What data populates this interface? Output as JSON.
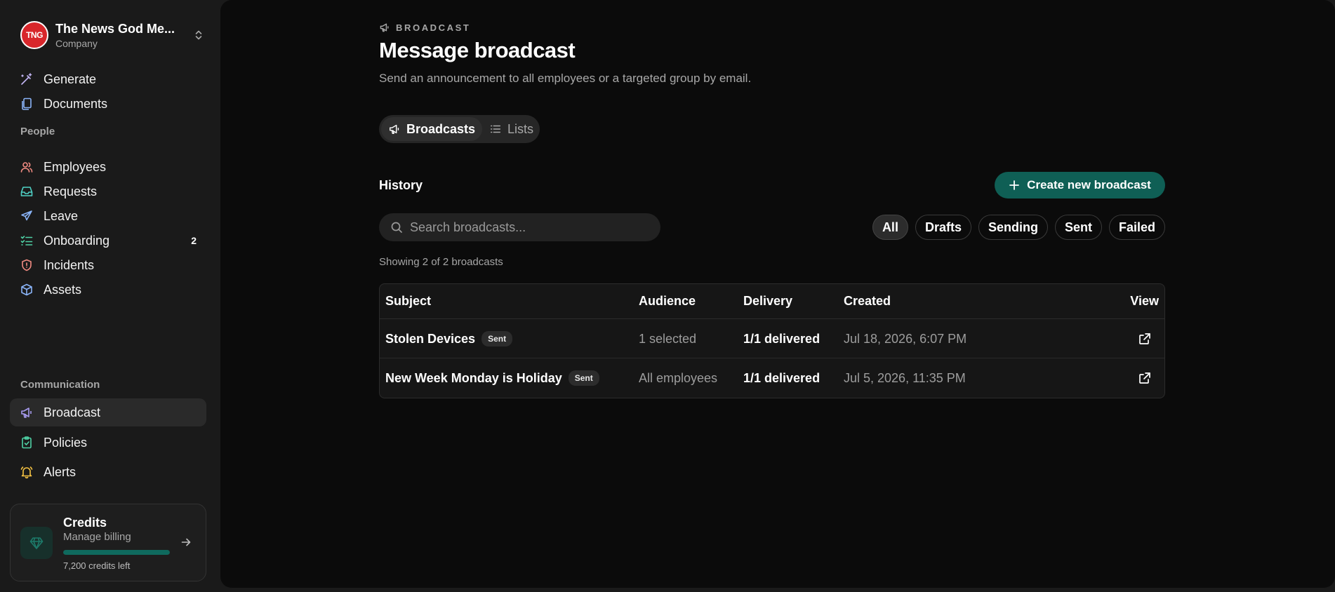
{
  "org": {
    "logo_text": "TNG",
    "name": "The News God Me...",
    "type": "Company"
  },
  "nav": {
    "top": [
      {
        "label": "Generate",
        "icon": "wand-icon",
        "color": "#c3b5f5"
      },
      {
        "label": "Documents",
        "icon": "documents-icon",
        "color": "#8ab4f8"
      }
    ],
    "people_label": "People",
    "people": [
      {
        "label": "Employees",
        "icon": "users-icon",
        "color": "#f28b82"
      },
      {
        "label": "Requests",
        "icon": "inbox-icon",
        "color": "#4fd1c5"
      },
      {
        "label": "Leave",
        "icon": "plane-icon",
        "color": "#8ab4f8"
      },
      {
        "label": "Onboarding",
        "icon": "checklist-icon",
        "color": "#4fd1a5",
        "count": "2"
      },
      {
        "label": "Incidents",
        "icon": "shield-alert-icon",
        "color": "#f28b82"
      },
      {
        "label": "Assets",
        "icon": "box-icon",
        "color": "#8ab4f8"
      }
    ],
    "communication_label": "Communication",
    "communication": [
      {
        "label": "Broadcast",
        "icon": "megaphone-icon",
        "color": "#a89cf0",
        "active": true
      },
      {
        "label": "Policies",
        "icon": "clipboard-check-icon",
        "color": "#4fd1a5"
      },
      {
        "label": "Alerts",
        "icon": "bell-icon",
        "color": "#f6c343"
      }
    ]
  },
  "credits": {
    "title": "Credits",
    "subtitle": "Manage billing",
    "remaining_label": "7,200 credits left",
    "progress_pct": 100,
    "accent": "#0f6a5e"
  },
  "header": {
    "eyebrow": "BROADCAST",
    "title": "Message broadcast",
    "subtitle": "Send an announcement to all employees or a targeted group by email."
  },
  "tabs": [
    {
      "label": "Broadcasts",
      "active": true
    },
    {
      "label": "Lists",
      "active": false
    }
  ],
  "history": {
    "title": "History",
    "create_label": "Create new broadcast",
    "create_color": "#0f5f55",
    "search_placeholder": "Search broadcasts...",
    "filters": [
      "All",
      "Drafts",
      "Sending",
      "Sent",
      "Failed"
    ],
    "active_filter": "All",
    "showing": "Showing 2 of 2 broadcasts"
  },
  "table": {
    "columns": [
      "Subject",
      "Audience",
      "Delivery",
      "Created",
      "View"
    ],
    "rows": [
      {
        "subject": "Stolen Devices",
        "status": "Sent",
        "audience": "1 selected",
        "delivery": "1/1 delivered",
        "created": "Jul 18, 2026, 6:07 PM"
      },
      {
        "subject": "New Week Monday is Holiday",
        "status": "Sent",
        "audience": "All employees",
        "delivery": "1/1 delivered",
        "created": "Jul 5, 2026, 11:35 PM"
      }
    ]
  }
}
